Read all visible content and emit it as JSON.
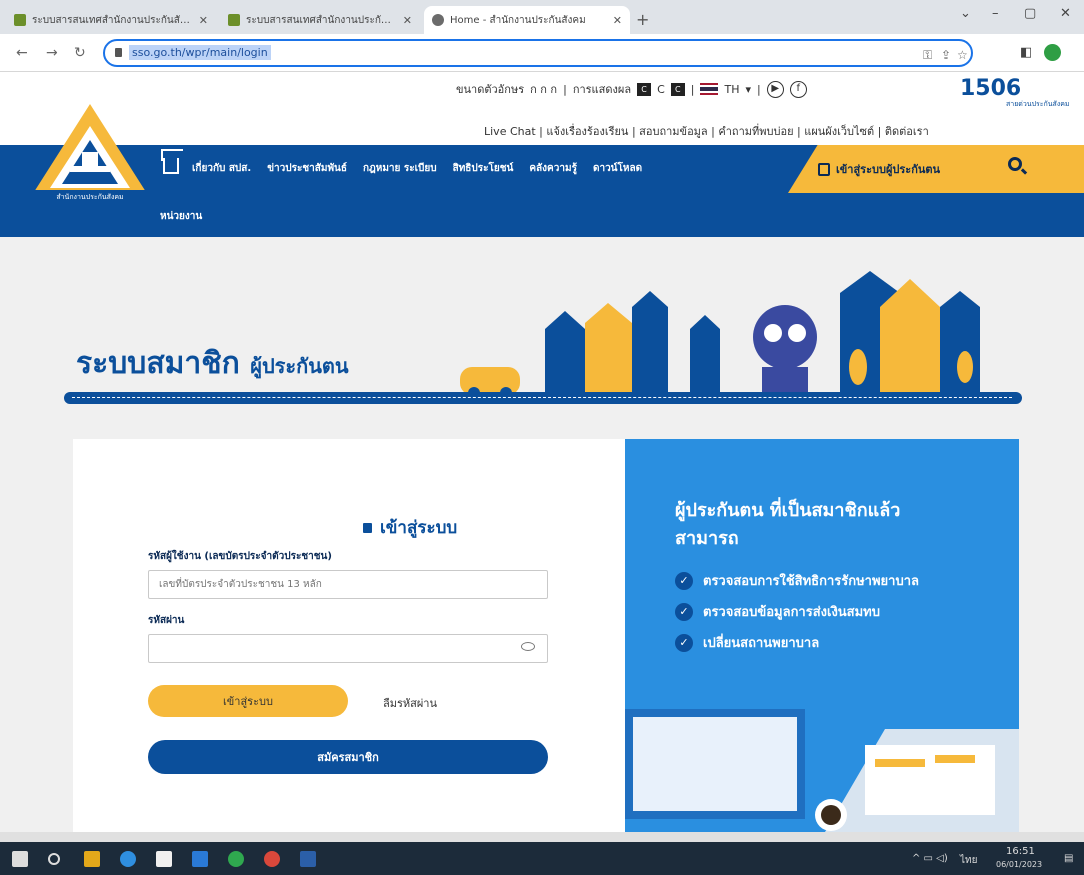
{
  "browser": {
    "tabs": [
      {
        "title": "ระบบสารสนเทศสำนักงานประกันสังคม"
      },
      {
        "title": "ระบบสารสนเทศสำนักงานประกันสังคม"
      },
      {
        "title": "Home - สำนักงานประกันสังคม"
      }
    ],
    "url": "sso.go.th/wpr/main/login",
    "new_tab": "+",
    "controls": {
      "min": "–",
      "max": "▢",
      "close": "✕"
    }
  },
  "site": {
    "font_size_label": "ขนาดตัวอักษร",
    "font_sizes": "ก ก ก",
    "display_label": "การแสดงผล",
    "contrast_c": "C",
    "lang": "TH",
    "hotline": "1506",
    "hotline_sub": "สายด่วนประกันสังคม",
    "links": [
      "Live Chat",
      "แจ้งเรื่องร้องเรียน",
      "สอบถามข้อมูล",
      "คำถามที่พบบ่อย",
      "แผนผังเว็บไซต์",
      "ติดต่อเรา"
    ],
    "logo_text": "สำนักงานประกันสังคม",
    "nav": [
      "เกี่ยวกับ สปส.",
      "ข่าวประชาสัมพันธ์",
      "กฎหมาย ระเบียบ",
      "สิทธิประโยชน์",
      "คลังความรู้",
      "ดาวน์โหลด"
    ],
    "nav_second": "หน่วยงาน",
    "nav_login": "เข้าสู่ระบบผู้ประกันตน",
    "banner_title": "ระบบสมาชิก",
    "banner_sub": "ผู้ประกันตน"
  },
  "login": {
    "title": "เข้าสู่ระบบ",
    "user_label": "รหัสผู้ใช้งาน (เลขบัตรประจำตัวประชาชน)",
    "user_placeholder": "เลขที่บัตรประจำตัวประชาชน 13 หลัก",
    "pass_label": "รหัสผ่าน",
    "login_button": "เข้าสู่ระบบ",
    "forgot": "ลืมรหัสผ่าน",
    "register_button": "สมัครสมาชิก"
  },
  "info": {
    "heading_line1": "ผู้ประกันตน ที่เป็นสมาชิกแล้ว",
    "heading_line2": "สามารถ",
    "benefits": [
      "ตรวจสอบการใช้สิทธิการรักษาพยาบาล",
      "ตรวจสอบข้อมูลการส่งเงินสมทบ",
      "เปลี่ยนสถานพยาบาล"
    ]
  },
  "taskbar": {
    "time": "16:51",
    "date": "06/01/2023",
    "lang": "ไทย"
  }
}
